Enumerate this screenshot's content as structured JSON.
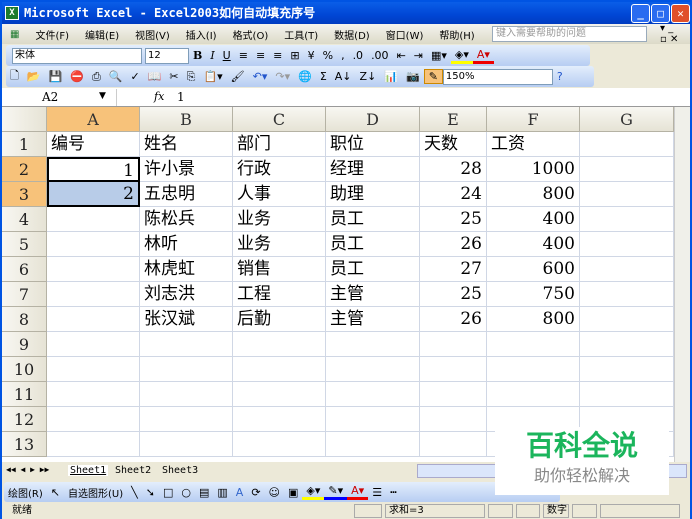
{
  "title": "Microsoft Excel - Excel2003如何自动填充序号",
  "menu": [
    "文件(F)",
    "编辑(E)",
    "视图(V)",
    "插入(I)",
    "格式(O)",
    "工具(T)",
    "数据(D)",
    "窗口(W)",
    "帮助(H)"
  ],
  "help_placeholder": "键入需要帮助的问题",
  "format_toolbar": {
    "font": "宋体",
    "size": "12",
    "bold": "B",
    "italic": "I",
    "underline": "U",
    "percent": "%",
    "comma": ","
  },
  "standard_toolbar": {
    "zoom": "150%",
    "sigma": "Σ"
  },
  "formula_bar": {
    "name_box": "A2",
    "fx": "fx",
    "value": "1"
  },
  "columns": [
    "A",
    "B",
    "C",
    "D",
    "E",
    "F",
    "G"
  ],
  "rows": [
    "1",
    "2",
    "3",
    "4",
    "5",
    "6",
    "7",
    "8",
    "9",
    "10",
    "11",
    "12",
    "13"
  ],
  "cells": [
    [
      "编号",
      "姓名",
      "部门",
      "职位",
      "天数",
      "工资"
    ],
    [
      "1",
      "许小景",
      "行政",
      "经理",
      "28",
      "1000"
    ],
    [
      "2",
      "五忠明",
      "人事",
      "助理",
      "24",
      "800"
    ],
    [
      "",
      "陈松兵",
      "业务",
      "员工",
      "25",
      "400"
    ],
    [
      "",
      "林听",
      "业务",
      "员工",
      "26",
      "400"
    ],
    [
      "",
      "林虎虹",
      "销售",
      "员工",
      "27",
      "600"
    ],
    [
      "",
      "刘志洪",
      "工程",
      "主管",
      "25",
      "750"
    ],
    [
      "",
      "张汉斌",
      "后勤",
      "主管",
      "26",
      "800"
    ]
  ],
  "sheets": [
    "Sheet1",
    "Sheet2",
    "Sheet3"
  ],
  "drawing_toolbar": {
    "draw": "绘图(R)",
    "autoshapes": "自选图形(U)"
  },
  "status": {
    "ready": "就绪",
    "sum": "求和=3",
    "numlock": "数字"
  },
  "watermark": {
    "brand": "百科全说",
    "slogan": "助你轻松解决"
  }
}
